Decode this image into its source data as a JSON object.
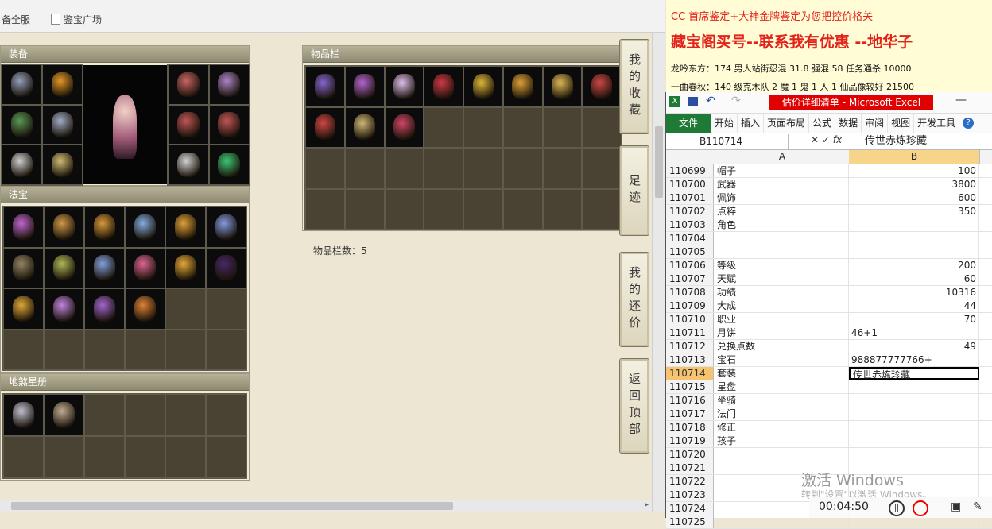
{
  "browser": {
    "bookmarks": [
      "备全服",
      "鉴宝广场"
    ]
  },
  "panels": {
    "equipment": {
      "title": "装备"
    },
    "fabao": {
      "title": "法宝"
    },
    "disha": {
      "title": "地煞星册"
    },
    "inventory": {
      "title": "物品栏",
      "count_label": "物品栏数：5"
    }
  },
  "side_tabs": [
    {
      "label": "我的收藏"
    },
    {
      "label": "足迹"
    },
    {
      "label": "我的还价"
    },
    {
      "label": "返回顶部"
    }
  ],
  "doc": {
    "line1": "CC 首席鉴定+大神金牌鉴定为您把控价格关",
    "line2": "藏宝阁买号--联系我有优惠 --地华子",
    "line3": "龙吟东方：174 男人站街忍混 31.8 强混 58 任务通杀 10000",
    "line4": "一曲春秋：140 级克木队 2 魔 1 鬼 1 人 1 仙品像较好 21500",
    "colors": {
      "line1": "#e2231a",
      "line2": "#e2231a",
      "line3": "#111111",
      "line4": "#111111"
    }
  },
  "excel": {
    "title": "估价详细清单 - Microsoft Excel",
    "tabs": [
      "文件",
      "开始",
      "插入",
      "页面布局",
      "公式",
      "数据",
      "审阅",
      "视图",
      "开发工具"
    ],
    "name_box": "B110714",
    "formula_value": "传世赤炼珍藏",
    "col_a": "A",
    "col_b": "B",
    "rows": [
      {
        "n": "110699",
        "a": "帽子",
        "b": "100"
      },
      {
        "n": "110700",
        "a": "武器",
        "b": "3800"
      },
      {
        "n": "110701",
        "a": "佩饰",
        "b": "600"
      },
      {
        "n": "110702",
        "a": "点粹",
        "b": "350"
      },
      {
        "n": "110703",
        "a": "角色",
        "b": ""
      },
      {
        "n": "110704",
        "a": "",
        "b": ""
      },
      {
        "n": "110705",
        "a": "",
        "b": ""
      },
      {
        "n": "110706",
        "a": "等级",
        "b": "200"
      },
      {
        "n": "110707",
        "a": "天赋",
        "b": "60"
      },
      {
        "n": "110708",
        "a": "功绩",
        "b": "10316"
      },
      {
        "n": "110709",
        "a": "大成",
        "b": "44"
      },
      {
        "n": "110710",
        "a": "职业",
        "b": "70"
      },
      {
        "n": "110711",
        "a": "月饼",
        "b": "46+1"
      },
      {
        "n": "110712",
        "a": "兑换点数",
        "b": "49"
      },
      {
        "n": "110713",
        "a": "宝石",
        "b": "988877777766+"
      },
      {
        "n": "110714",
        "a": "套装",
        "b": "传世赤炼珍藏"
      },
      {
        "n": "110715",
        "a": "星盘",
        "b": ""
      },
      {
        "n": "110716",
        "a": "坐骑",
        "b": ""
      },
      {
        "n": "110717",
        "a": "法门",
        "b": ""
      },
      {
        "n": "110718",
        "a": "修正",
        "b": ""
      },
      {
        "n": "110719",
        "a": "孩子",
        "b": ""
      },
      {
        "n": "110720",
        "a": "",
        "b": ""
      },
      {
        "n": "110721",
        "a": "",
        "b": ""
      },
      {
        "n": "110722",
        "a": "",
        "b": ""
      },
      {
        "n": "110723",
        "a": "",
        "b": ""
      },
      {
        "n": "110724",
        "a": "",
        "b": ""
      },
      {
        "n": "110725",
        "a": "",
        "b": ""
      }
    ]
  },
  "overlay": {
    "watermark": "激活 Windows",
    "watermark_sub": "转到\"设置\"以激活 Windows。",
    "timer": "00:04:50"
  }
}
